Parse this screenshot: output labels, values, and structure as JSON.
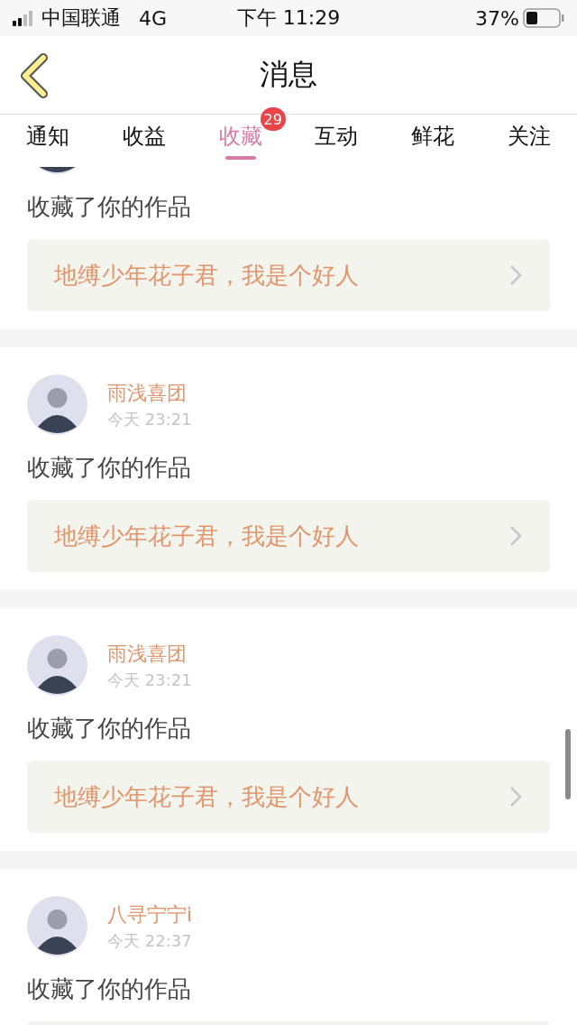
{
  "status_bar": {
    "carrier": "中国联通",
    "network": "4G",
    "time": "下午 11:29",
    "battery": "37%"
  },
  "nav": {
    "title": "消息"
  },
  "tabs": [
    {
      "label": "通知",
      "selected": false
    },
    {
      "label": "收益",
      "selected": false
    },
    {
      "label": "收藏",
      "selected": true,
      "badge": "29"
    },
    {
      "label": "互动",
      "selected": false
    },
    {
      "label": "鲜花",
      "selected": false
    },
    {
      "label": "关注",
      "selected": false
    }
  ],
  "messages": [
    {
      "action": "收藏了你的作品",
      "work": "地缚少年花子君，我是个好人"
    },
    {
      "name": "雨浅喜团",
      "time": "今天 23:21",
      "action": "收藏了你的作品",
      "work": "地缚少年花子君，我是个好人"
    },
    {
      "name": "雨浅喜团",
      "time": "今天 23:21",
      "action": "收藏了你的作品",
      "work": "地缚少年花子君，我是个好人"
    },
    {
      "name": "八寻宁宁i",
      "time": "今天 22:37",
      "action": "收藏了你的作品"
    }
  ]
}
